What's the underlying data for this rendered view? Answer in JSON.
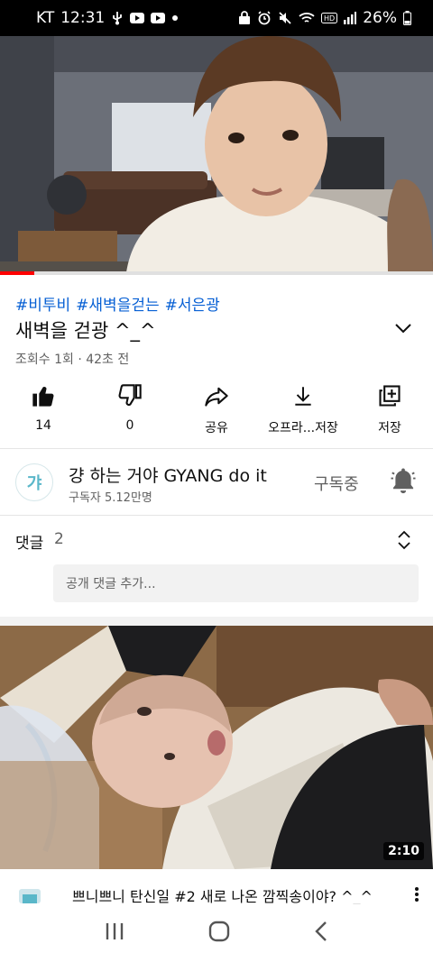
{
  "status_bar": {
    "carrier": "KT",
    "time": "12:31",
    "battery": "26%",
    "icons_left": [
      "usb-icon",
      "youtube-icon",
      "youtube-icon",
      "dot-icon"
    ],
    "icons_right": [
      "lock-icon",
      "alarm-icon",
      "mute-icon",
      "wifi-icon",
      "hd-icon",
      "signal-icon",
      "battery-icon"
    ]
  },
  "player": {
    "progress": 0.08
  },
  "video": {
    "hashtags": [
      "#비투비",
      "#새벽을걷는",
      "#서은광"
    ],
    "title": "새벽을 걷광 ^_^",
    "meta": "조회수 1회 · 42초 전"
  },
  "actions": [
    {
      "icon": "like-icon",
      "label": "14"
    },
    {
      "icon": "dislike-icon",
      "label": "0"
    },
    {
      "icon": "share-icon",
      "label": "공유"
    },
    {
      "icon": "download-icon",
      "label": "오프라...저장"
    },
    {
      "icon": "save-icon",
      "label": "저장"
    }
  ],
  "channel": {
    "avatar_text": "갸",
    "name": "걍 하는 거야 GYANG do it",
    "subscribers": "구독자 5.12만명",
    "subscribed_label": "구독중"
  },
  "comments": {
    "label": "댓글",
    "count": "2",
    "placeholder": "공개 댓글 추가..."
  },
  "next_video": {
    "duration": "2:10",
    "title": "쁘니쁘니 탄신일 #2 새로 나온 깜찍송이야? ^_^"
  },
  "colors": {
    "accent": "#065fd4",
    "progress": "#ff0000"
  }
}
